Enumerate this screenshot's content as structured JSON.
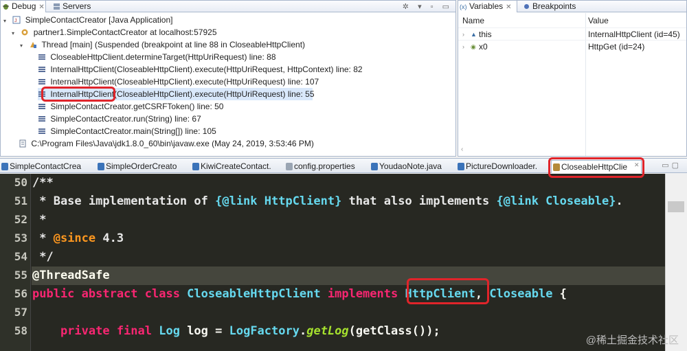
{
  "debug": {
    "tab_debug": "Debug",
    "tab_servers": "Servers",
    "rows": [
      "SimpleContactCreator [Java Application]",
      "partner1.SimpleContactCreator at localhost:57925",
      "Thread [main] (Suspended (breakpoint at line 88 in CloseableHttpClient)",
      "CloseableHttpClient.determineTarget(HttpUriRequest) line: 88",
      "InternalHttpClient(CloseableHttpClient).execute(HttpUriRequest, HttpContext) line: 82",
      "InternalHttpClient(CloseableHttpClient).execute(HttpUriRequest) line: 107",
      "InternalHttpClient(CloseableHttpClient).execute(HttpUriRequest) line: 55",
      "SimpleContactCreator.getCSRFToken() line: 50",
      "SimpleContactCreator.run(String) line: 67",
      "SimpleContactCreator.main(String[]) line: 105",
      "C:\\Program Files\\Java\\jdk1.8.0_60\\bin\\javaw.exe (May 24, 2019, 3:53:46 PM)"
    ]
  },
  "variables": {
    "tab_variables": "Variables",
    "tab_breakpoints": "Breakpoints",
    "col_name": "Name",
    "col_value": "Value",
    "rows": [
      {
        "name": "this",
        "value": "InternalHttpClient  (id=45)"
      },
      {
        "name": "x0",
        "value": "HttpGet  (id=24)"
      }
    ]
  },
  "editor_tabs": [
    "SimpleContactCrea",
    "SimpleOrderCreato",
    "KiwiCreateContact.",
    "config.properties",
    "YoudaoNote.java",
    "PictureDownloader.",
    "CloseableHttpClie"
  ],
  "editor": {
    "line_numbers": [
      "50",
      "51",
      "52",
      "53",
      "54",
      "55",
      "56",
      "57",
      "58"
    ],
    "l50": "/**",
    "l51_a": " * Base implementation of ",
    "l51_b": "{@link HttpClient}",
    "l51_c": " that also implements ",
    "l51_d": "{@link Closeable}",
    "l51_e": ".",
    "l52": " *",
    "l53_a": " * ",
    "l53_b": "@since",
    "l53_c": " 4.3",
    "l54": " */",
    "l55": "@ThreadSafe",
    "l56_kw": "public abstract class ",
    "l56_cls": "CloseableHttpClient",
    "l56_impl": " implements ",
    "l56_if1": "HttpClient",
    "l56_comma": ", ",
    "l56_if2": "Closeable",
    "l56_brace": " {",
    "l58_kw": "    private final ",
    "l58_type": "Log",
    "l58_var": " log = ",
    "l58_cls": "LogFactory",
    "l58_dot": ".",
    "l58_fn": "getLog",
    "l58_rest": "(getClass());"
  },
  "watermark": "@稀土掘金技术社区",
  "colors": {
    "accent_red": "#e0242a",
    "editor_bg": "#272822",
    "keyword": "#f92672",
    "type": "#66d9ef"
  }
}
